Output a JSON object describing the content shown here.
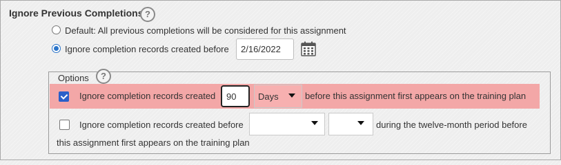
{
  "section": {
    "title": "Ignore Previous Completions",
    "help_icon": "question-circle-icon"
  },
  "radios": {
    "default_label": "Default: All previous completions will be considered for this assignment",
    "default_selected": false,
    "ignore_before_label": "Ignore completion records created before",
    "ignore_before_selected": true,
    "date_value": "2/16/2022",
    "calendar_icon": "calendar-icon"
  },
  "options": {
    "legend": "Options",
    "row1": {
      "checked": true,
      "label_before": "Ignore completion records created",
      "number_value": "90",
      "unit_selected": "Days",
      "label_after": "before this assignment first appears on the training plan",
      "highlight_color": "#f3a7a7"
    },
    "row2": {
      "checked": false,
      "label_before": "Ignore completion records created before",
      "select1_value": "",
      "select2_value": "",
      "label_after": "during the twelve-month period before",
      "label_wrap": "this assignment first appears on the training plan"
    }
  },
  "colors": {
    "accent": "#2a74c9",
    "background": "#eeeeee"
  }
}
